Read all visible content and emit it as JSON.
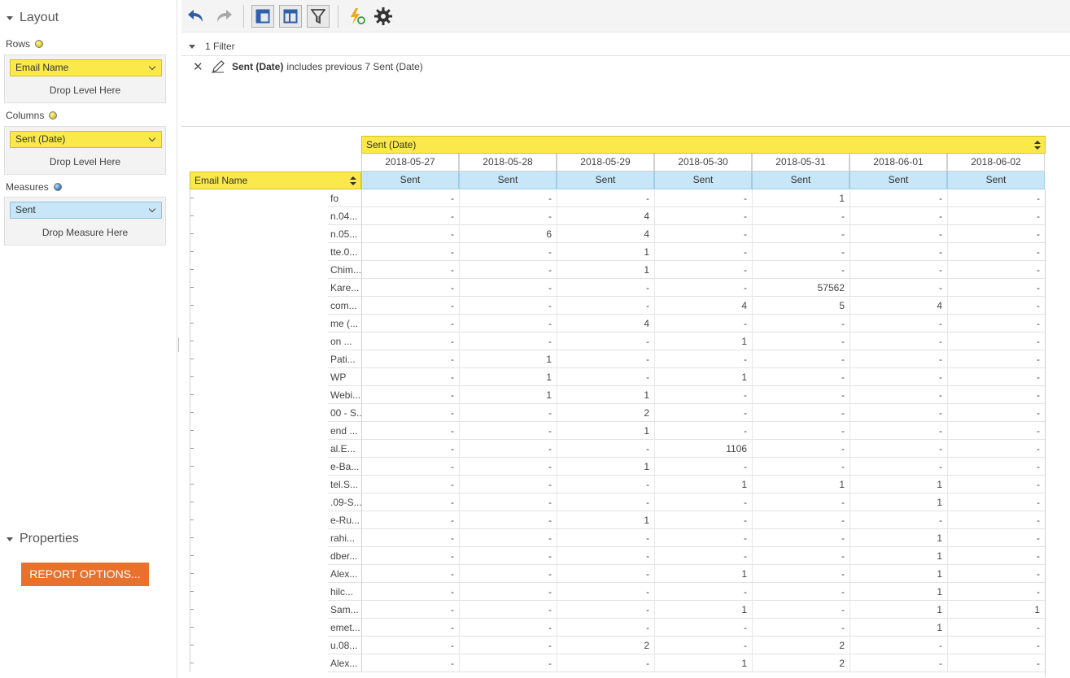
{
  "layout": {
    "title": "Layout",
    "rows_label": "Rows",
    "rows_level": "Email Name",
    "columns_label": "Columns",
    "columns_level": "Sent (Date)",
    "measures_label": "Measures",
    "measures_level": "Sent",
    "drop_level_hint": "Drop Level Here",
    "drop_measure_hint": "Drop Measure Here"
  },
  "properties": {
    "title": "Properties",
    "report_options_label": "REPORT OPTIONS..."
  },
  "toolbar": {
    "icons": [
      "undo-icon",
      "redo-icon",
      "layout-panel-icon",
      "table-layout-icon",
      "filter-icon",
      "refresh-lightning-icon",
      "settings-gear-icon"
    ]
  },
  "filter": {
    "count_label": "1 Filter",
    "field": "Sent (Date)",
    "condition": "includes previous 7 Sent (Date)"
  },
  "pivot": {
    "column_dimension": "Sent (Date)",
    "row_dimension": "Email Name",
    "dates": [
      "2018-05-27",
      "2018-05-28",
      "2018-05-29",
      "2018-05-30",
      "2018-05-31",
      "2018-06-01",
      "2018-06-02"
    ],
    "measure": "Sent",
    "rows": [
      {
        "label": "fo",
        "values": [
          "-",
          "-",
          "-",
          "-",
          "1",
          "-",
          "-"
        ]
      },
      {
        "label": "n.04...",
        "values": [
          "-",
          "-",
          "4",
          "-",
          "-",
          "-",
          "-"
        ]
      },
      {
        "label": "n.05...",
        "values": [
          "-",
          "6",
          "4",
          "-",
          "-",
          "-",
          "-"
        ]
      },
      {
        "label": "tte.0...",
        "values": [
          "-",
          "-",
          "1",
          "-",
          "-",
          "-",
          "-"
        ]
      },
      {
        "label": "Chim...",
        "values": [
          "-",
          "-",
          "1",
          "-",
          "-",
          "-",
          "-"
        ]
      },
      {
        "label": "Kare...",
        "values": [
          "-",
          "-",
          "-",
          "-",
          "57562",
          "-",
          "-"
        ]
      },
      {
        "label": "com...",
        "values": [
          "-",
          "-",
          "-",
          "4",
          "5",
          "4",
          "-"
        ]
      },
      {
        "label": "me (...",
        "values": [
          "-",
          "-",
          "4",
          "-",
          "-",
          "-",
          "-"
        ]
      },
      {
        "label": "on ...",
        "values": [
          "-",
          "-",
          "-",
          "1",
          "-",
          "-",
          "-"
        ]
      },
      {
        "label": "Pati...",
        "values": [
          "-",
          "1",
          "-",
          "-",
          "-",
          "-",
          "-"
        ]
      },
      {
        "label": "WP",
        "values": [
          "-",
          "1",
          "-",
          "1",
          "-",
          "-",
          "-"
        ]
      },
      {
        "label": "Webi...",
        "values": [
          "-",
          "1",
          "1",
          "-",
          "-",
          "-",
          "-"
        ]
      },
      {
        "label": "00 - S...",
        "values": [
          "-",
          "-",
          "2",
          "-",
          "-",
          "-",
          "-"
        ]
      },
      {
        "label": "end ...",
        "values": [
          "-",
          "-",
          "1",
          "-",
          "-",
          "-",
          "-"
        ]
      },
      {
        "label": "al.E...",
        "values": [
          "-",
          "-",
          "-",
          "1106",
          "-",
          "-",
          "-"
        ]
      },
      {
        "label": "e-Ba...",
        "values": [
          "-",
          "-",
          "1",
          "-",
          "-",
          "-",
          "-"
        ]
      },
      {
        "label": "tel.S...",
        "values": [
          "-",
          "-",
          "-",
          "1",
          "1",
          "1",
          "-"
        ]
      },
      {
        "label": ".09-S...",
        "values": [
          "-",
          "-",
          "-",
          "-",
          "-",
          "1",
          "-"
        ]
      },
      {
        "label": "e-Ru...",
        "values": [
          "-",
          "-",
          "1",
          "-",
          "-",
          "-",
          "-"
        ]
      },
      {
        "label": "rahi...",
        "values": [
          "-",
          "-",
          "-",
          "-",
          "-",
          "1",
          "-"
        ]
      },
      {
        "label": "dber...",
        "values": [
          "-",
          "-",
          "-",
          "-",
          "-",
          "1",
          "-"
        ]
      },
      {
        "label": "Alex...",
        "values": [
          "-",
          "-",
          "-",
          "1",
          "-",
          "1",
          "-"
        ]
      },
      {
        "label": "hilc...",
        "values": [
          "-",
          "-",
          "-",
          "-",
          "-",
          "1",
          "-"
        ]
      },
      {
        "label": "Sam...",
        "values": [
          "-",
          "-",
          "-",
          "1",
          "-",
          "1",
          "1"
        ]
      },
      {
        "label": "emet...",
        "values": [
          "-",
          "-",
          "-",
          "-",
          "-",
          "1",
          "-"
        ]
      },
      {
        "label": "u.08...",
        "values": [
          "-",
          "-",
          "2",
          "-",
          "2",
          "-",
          "-"
        ]
      },
      {
        "label": "Alex...",
        "values": [
          "-",
          "-",
          "-",
          "1",
          "2",
          "-",
          "-"
        ]
      }
    ]
  },
  "colors": {
    "yellow_header": "#fbe94c",
    "measure_header": "#c7e6f7",
    "report_button": "#e8722c"
  }
}
